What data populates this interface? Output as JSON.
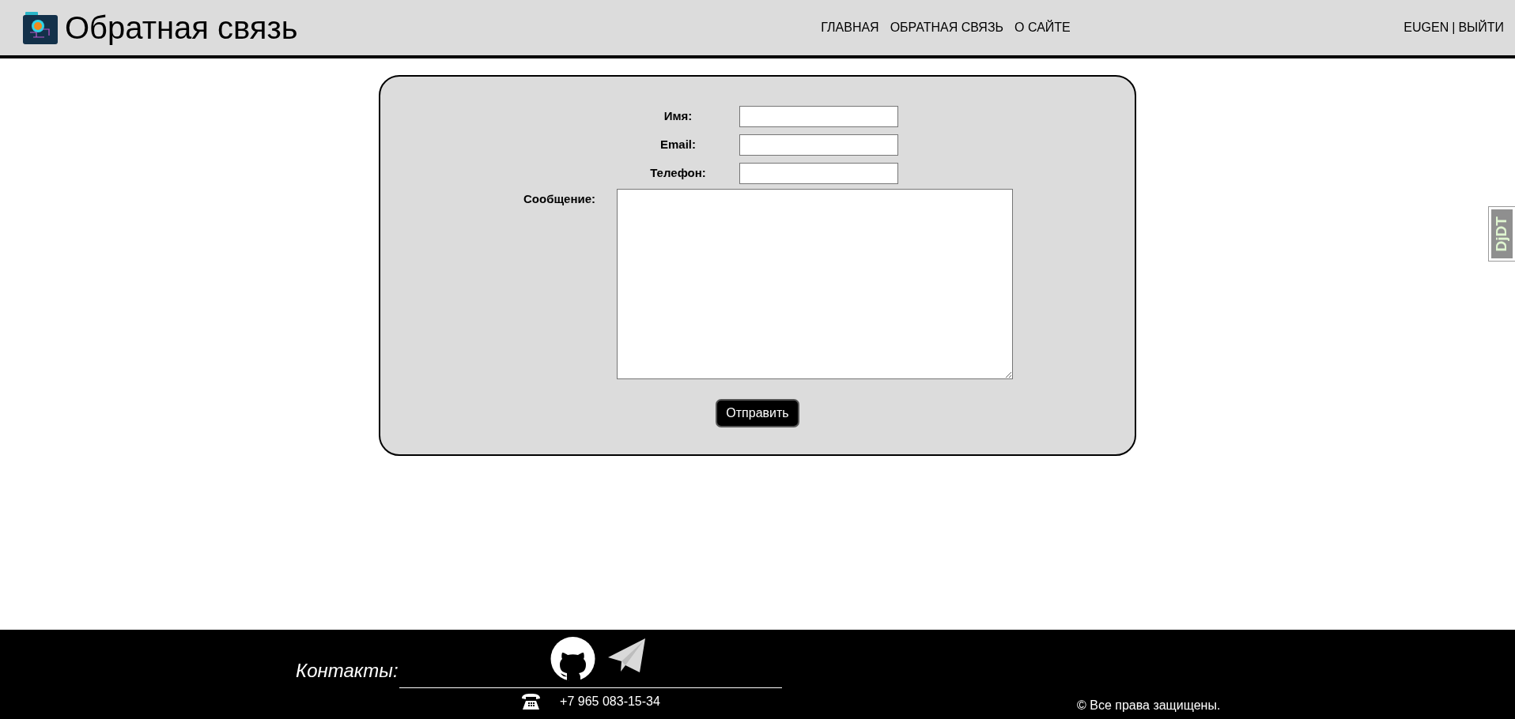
{
  "header": {
    "title": "Обратная связь",
    "nav": [
      {
        "label": "ГЛАВНАЯ"
      },
      {
        "label": "ОБРАТНАЯ СВЯЗЬ"
      },
      {
        "label": "О САЙТЕ"
      }
    ],
    "user": "EUGEN",
    "separator": "|",
    "logout": "ВЫЙТИ"
  },
  "form": {
    "fields": [
      {
        "label": "Имя:",
        "kind": "input"
      },
      {
        "label": "Email:",
        "kind": "input"
      },
      {
        "label": "Телефон:",
        "kind": "input"
      },
      {
        "label": "Сообщение:",
        "kind": "textarea"
      }
    ],
    "submit": "Отправить"
  },
  "debug_handle": "DjDT",
  "footer": {
    "contacts_label": "Контакты:",
    "phone": "+7 965 083-15-34",
    "copyright": "© Все права защищены."
  }
}
